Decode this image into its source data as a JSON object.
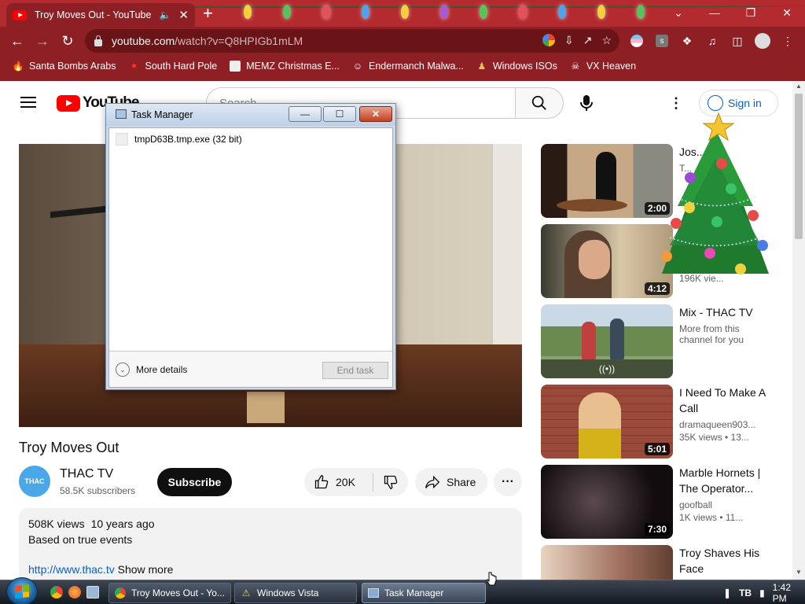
{
  "browser": {
    "tab_title": "Troy Moves Out - YouTube",
    "tab_audio_icon": "speaker-icon",
    "url_host": "youtube.com",
    "url_path": "/watch?v=Q8HPIGb1mLM",
    "bookmarks": [
      {
        "label": "Santa Bombs Arabs",
        "icon": "fire-icon"
      },
      {
        "label": "South Hard Pole",
        "icon": "star-icon"
      },
      {
        "label": "MEMZ Christmas E...",
        "icon": "page-icon"
      },
      {
        "label": "Endermanch Malwa...",
        "icon": "face-icon"
      },
      {
        "label": "Windows ISOs",
        "icon": "person-icon"
      },
      {
        "label": "VX Heaven",
        "icon": "skull-icon"
      }
    ],
    "theme_color": "#8e1f24"
  },
  "youtube": {
    "logo_text": "YouTube",
    "search_placeholder": "Search",
    "sign_in": "Sign in",
    "video": {
      "title": "Troy Moves Out",
      "channel": "THAC TV",
      "channel_avatar_text": "THAC",
      "subscribers": "58.5K subscribers",
      "subscribe": "Subscribe",
      "likes": "20K",
      "share": "Share",
      "views": "508K views",
      "age": "10 years ago",
      "description": "Based on true events",
      "link": "http://www.thac.tv",
      "show_more": "Show more"
    },
    "recommendations": [
      {
        "title": "Jos...",
        "line2": "T...",
        "channel": "",
        "meta": "",
        "duration": "2:00"
      },
      {
        "title": "",
        "channel": "",
        "meta": "196K vie...",
        "duration": "4:12"
      },
      {
        "title": "Mix - THAC TV",
        "channel": "More from this channel for you",
        "meta": "",
        "duration": ""
      },
      {
        "title": "I Need To Make A Call",
        "channel": "dramaqueen903...",
        "meta": "35K views • 13...",
        "duration": "5:01"
      },
      {
        "title": "Marble Hornets | The Operator...",
        "channel": "goofball",
        "meta": "1K views • 11...",
        "duration": "7:30"
      },
      {
        "title": "Troy Shaves His Face",
        "channel": "",
        "meta": "",
        "duration": ""
      }
    ]
  },
  "task_manager": {
    "title": "Task Manager",
    "process": "tmpD63B.tmp.exe (32 bit)",
    "more_details": "More details",
    "end_task": "End task"
  },
  "taskbar": {
    "tasks": [
      {
        "label": "Troy Moves Out - Yo...",
        "icon": "chrome-icon"
      },
      {
        "label": "Windows Vista",
        "icon": "warning-icon"
      },
      {
        "label": "Task Manager",
        "icon": "taskmanager-icon"
      }
    ],
    "clock": "1:42 PM"
  }
}
